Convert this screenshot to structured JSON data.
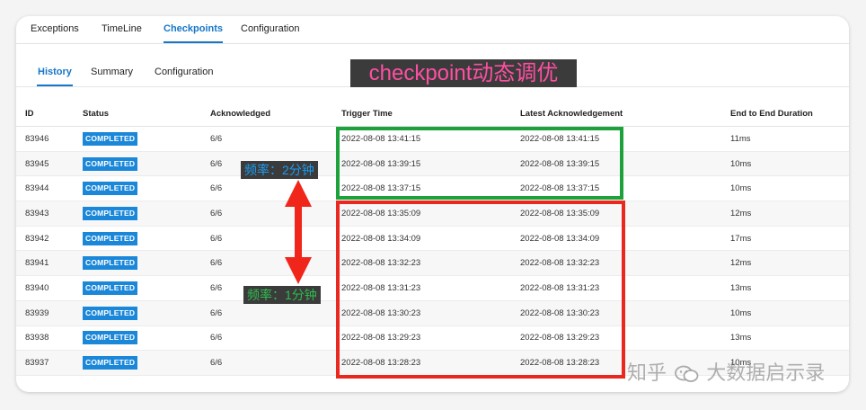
{
  "top_tabs": {
    "items": [
      {
        "label": "Exceptions"
      },
      {
        "label": "TimeLine"
      },
      {
        "label": "Checkpoints"
      },
      {
        "label": "Configuration"
      }
    ],
    "active": "Checkpoints"
  },
  "sub_tabs": {
    "items": [
      {
        "label": "History"
      },
      {
        "label": "Summary"
      },
      {
        "label": "Configuration"
      }
    ],
    "active": "History"
  },
  "overlay": {
    "title": "checkpoint动态调优",
    "note_2min": "频率：2分钟",
    "note_1min": "频率：1分钟"
  },
  "table": {
    "headers": [
      "ID",
      "Status",
      "Acknowledged",
      "Trigger Time",
      "Latest Acknowledgement",
      "End to End Duration"
    ],
    "rows": [
      {
        "id": "83946",
        "status": "COMPLETED",
        "ack": "6/6",
        "trigger": "2022-08-08 13:41:15",
        "latest": "2022-08-08 13:41:15",
        "duration": "11ms"
      },
      {
        "id": "83945",
        "status": "COMPLETED",
        "ack": "6/6",
        "trigger": "2022-08-08 13:39:15",
        "latest": "2022-08-08 13:39:15",
        "duration": "10ms"
      },
      {
        "id": "83944",
        "status": "COMPLETED",
        "ack": "6/6",
        "trigger": "2022-08-08 13:37:15",
        "latest": "2022-08-08 13:37:15",
        "duration": "10ms"
      },
      {
        "id": "83943",
        "status": "COMPLETED",
        "ack": "6/6",
        "trigger": "2022-08-08 13:35:09",
        "latest": "2022-08-08 13:35:09",
        "duration": "12ms"
      },
      {
        "id": "83942",
        "status": "COMPLETED",
        "ack": "6/6",
        "trigger": "2022-08-08 13:34:09",
        "latest": "2022-08-08 13:34:09",
        "duration": "17ms"
      },
      {
        "id": "83941",
        "status": "COMPLETED",
        "ack": "6/6",
        "trigger": "2022-08-08 13:32:23",
        "latest": "2022-08-08 13:32:23",
        "duration": "12ms"
      },
      {
        "id": "83940",
        "status": "COMPLETED",
        "ack": "6/6",
        "trigger": "2022-08-08 13:31:23",
        "latest": "2022-08-08 13:31:23",
        "duration": "13ms"
      },
      {
        "id": "83939",
        "status": "COMPLETED",
        "ack": "6/6",
        "trigger": "2022-08-08 13:30:23",
        "latest": "2022-08-08 13:30:23",
        "duration": "10ms"
      },
      {
        "id": "83938",
        "status": "COMPLETED",
        "ack": "6/6",
        "trigger": "2022-08-08 13:29:23",
        "latest": "2022-08-08 13:29:23",
        "duration": "13ms"
      },
      {
        "id": "83937",
        "status": "COMPLETED",
        "ack": "6/6",
        "trigger": "2022-08-08 13:28:23",
        "latest": "2022-08-08 13:28:23",
        "duration": "10ms"
      }
    ]
  },
  "watermark": {
    "prefix": "知乎",
    "logo_icon": "wechat-logo-icon",
    "suffix": "大数据启示录"
  },
  "colors": {
    "accent": "#1677c8",
    "badge": "#1b87d8",
    "green_box": "#1da23b",
    "red_box": "#e9291f",
    "overlay_title": "#ff4fa3"
  }
}
